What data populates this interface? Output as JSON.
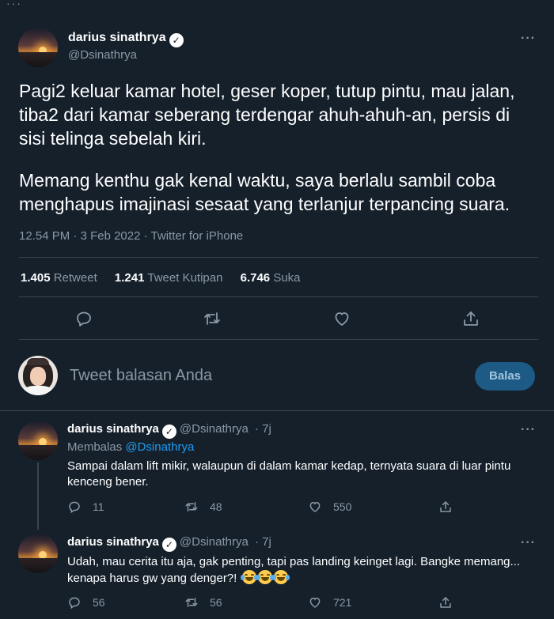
{
  "tweet": {
    "author_name": "darius sinathrya",
    "author_handle": "@Dsinathrya",
    "paragraph_1": "Pagi2 keluar kamar hotel, geser koper, tutup pintu, mau jalan, tiba2 dari kamar seberang terdengar ahuh-ahuh-an, persis di sisi telinga sebelah kiri.",
    "paragraph_2": "Memang kenthu gak kenal waktu, saya berlalu sambil coba menghapus imajinasi sesaat yang terlanjur terpancing suara.",
    "time": "12.54 PM",
    "date": "3 Feb 2022",
    "source": "Twitter for iPhone",
    "separator": "·"
  },
  "stats": {
    "retweets_count": "1.405",
    "retweets_label": "Retweet",
    "quotes_count": "1.241",
    "quotes_label": "Tweet Kutipan",
    "likes_count": "6.746",
    "likes_label": "Suka"
  },
  "composer": {
    "placeholder": "Tweet balasan Anda",
    "reply_button": "Balas"
  },
  "replies": [
    {
      "author_name": "darius sinathrya",
      "author_handle": "@Dsinathrya",
      "time": "· 7j",
      "replying_to_prefix": "Membalas",
      "replying_to_handle": "@Dsinathrya",
      "text": "Sampai dalam lift mikir, walaupun di dalam kamar kedap, ternyata suara di luar pintu kenceng bener.",
      "replies": "11",
      "retweets": "48",
      "likes": "550"
    },
    {
      "author_name": "darius sinathrya",
      "author_handle": "@Dsinathrya",
      "time": "· 7j",
      "text": "Udah, mau cerita itu aja, gak penting, tapi pas landing keinget lagi. Bangke memang... kenapa harus gw yang denger?!",
      "emoji": "face-with-tears-of-joy x3",
      "replies": "56",
      "retweets": "56",
      "likes": "721"
    }
  ],
  "colors": {
    "background": "#15202b",
    "secondary_text": "#8b98a5",
    "divider": "#38444d",
    "link": "#1d9bf0",
    "reply_button_bg": "#1e5a86"
  }
}
